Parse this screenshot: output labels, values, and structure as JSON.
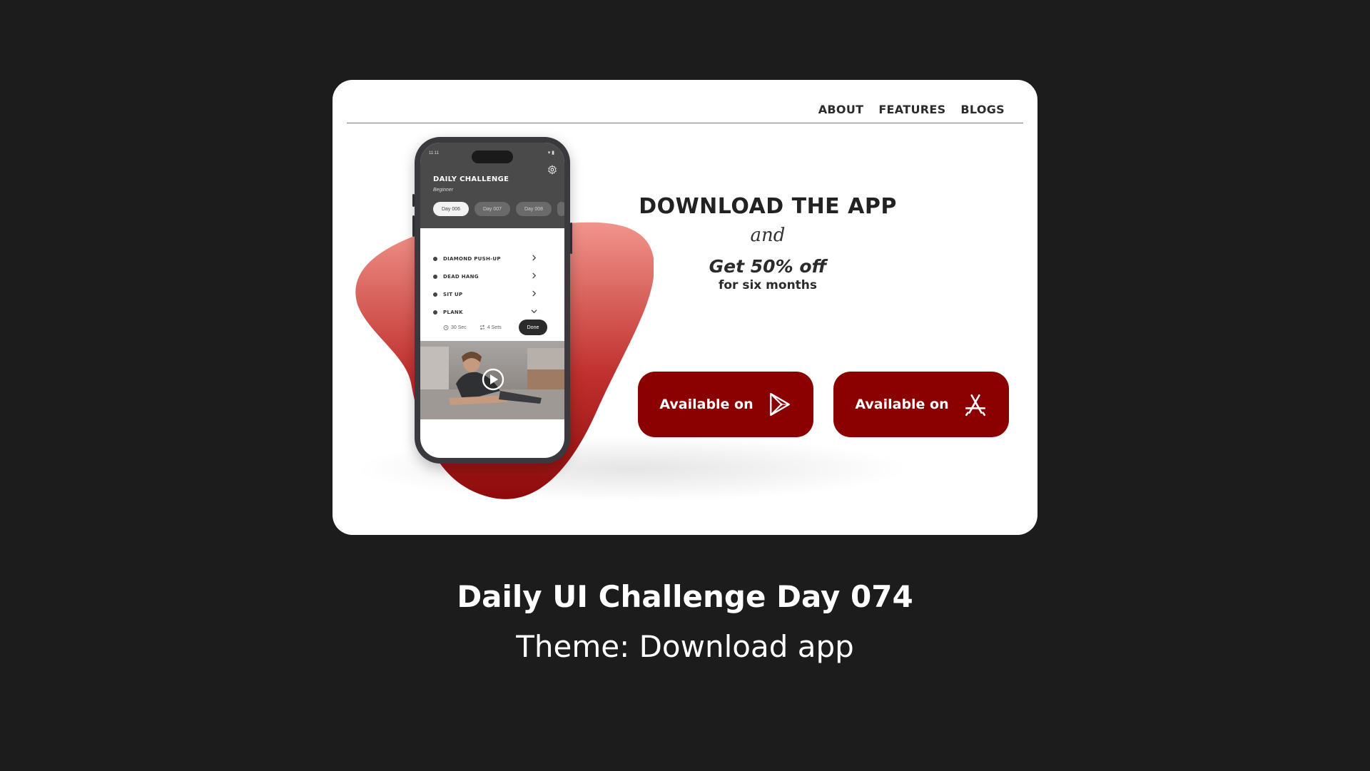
{
  "nav": {
    "items": [
      "ABOUT",
      "FEATURES",
      "BLOGS"
    ]
  },
  "phone": {
    "status_time": "11:11",
    "title": "DAILY CHALLENGE",
    "level": "Beginner",
    "days": [
      "Day 006",
      "Day 007",
      "Day 008"
    ],
    "exercises": [
      "DIAMOND PUSH-UP",
      "DEAD HANG",
      "SIT UP",
      "PLANK"
    ],
    "plank_duration": "30 Sec",
    "plank_sets": "4 Sets",
    "done_label": "Done",
    "icons": [
      "gear-icon",
      "play-icon",
      "timer-icon",
      "repeat-icon",
      "chevron-right-icon",
      "chevron-down-icon"
    ]
  },
  "hero": {
    "title": "DOWNLOAD THE APP",
    "and": "and",
    "offer": "Get 50% off",
    "duration": "for six months"
  },
  "buttons": {
    "google_play_label": "Available on",
    "app_store_label": "Available on",
    "icons": [
      "google-play-icon",
      "app-store-icon"
    ]
  },
  "caption": {
    "title": "Daily UI Challenge Day 074",
    "subtitle": "Theme: Download app"
  },
  "colors": {
    "background": "#1c1c1c",
    "accent": "#8b0000",
    "blob_top": "#f0958c",
    "blob_bottom": "#8e0b0b"
  }
}
